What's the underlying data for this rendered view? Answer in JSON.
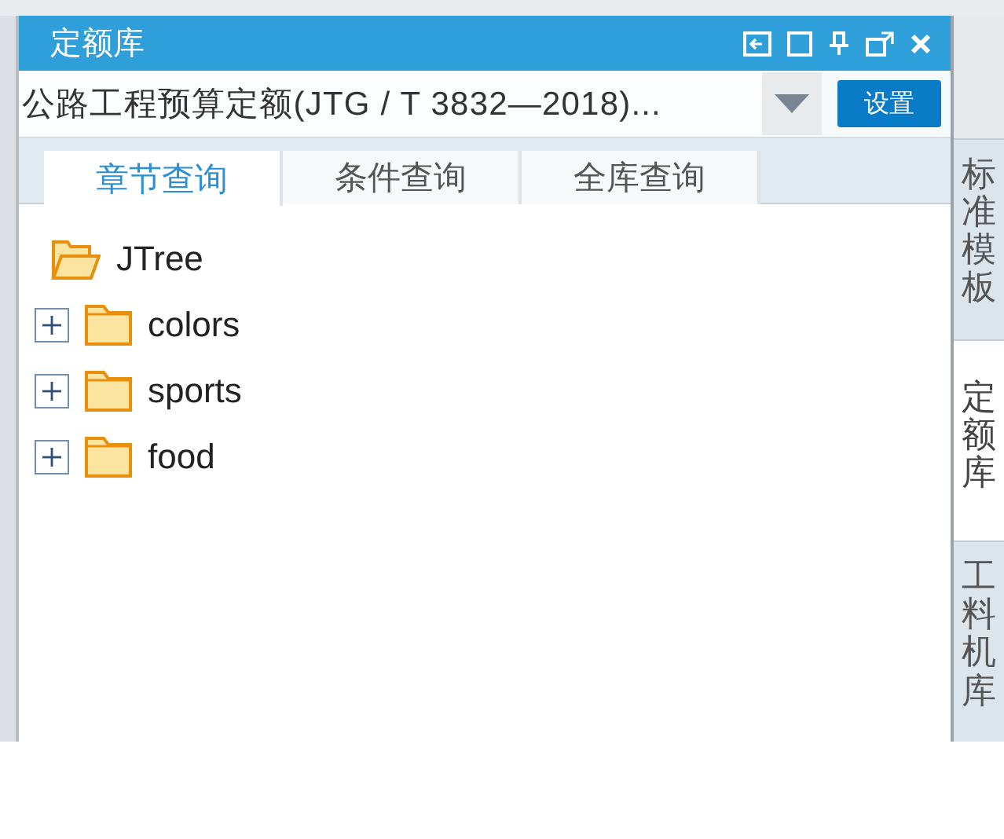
{
  "panel": {
    "title": "定额库"
  },
  "library_select": {
    "value": "公路工程预算定额(JTG / T 3832—2018)..."
  },
  "settings_button": {
    "label": "设置"
  },
  "tabs": [
    {
      "label": "章节查询",
      "selected": true
    },
    {
      "label": "条件查询",
      "selected": false
    },
    {
      "label": "全库查询",
      "selected": false
    }
  ],
  "tree": [
    {
      "label": "JTree",
      "expanded": true,
      "children": [
        {
          "label": "colors",
          "expanded": false
        },
        {
          "label": "sports",
          "expanded": false
        },
        {
          "label": "food",
          "expanded": false
        }
      ]
    }
  ],
  "side_tabs": [
    {
      "label": "标准模板",
      "selected": false
    },
    {
      "label": "定额库",
      "selected": true
    },
    {
      "label": "工料机库",
      "selected": false
    }
  ]
}
